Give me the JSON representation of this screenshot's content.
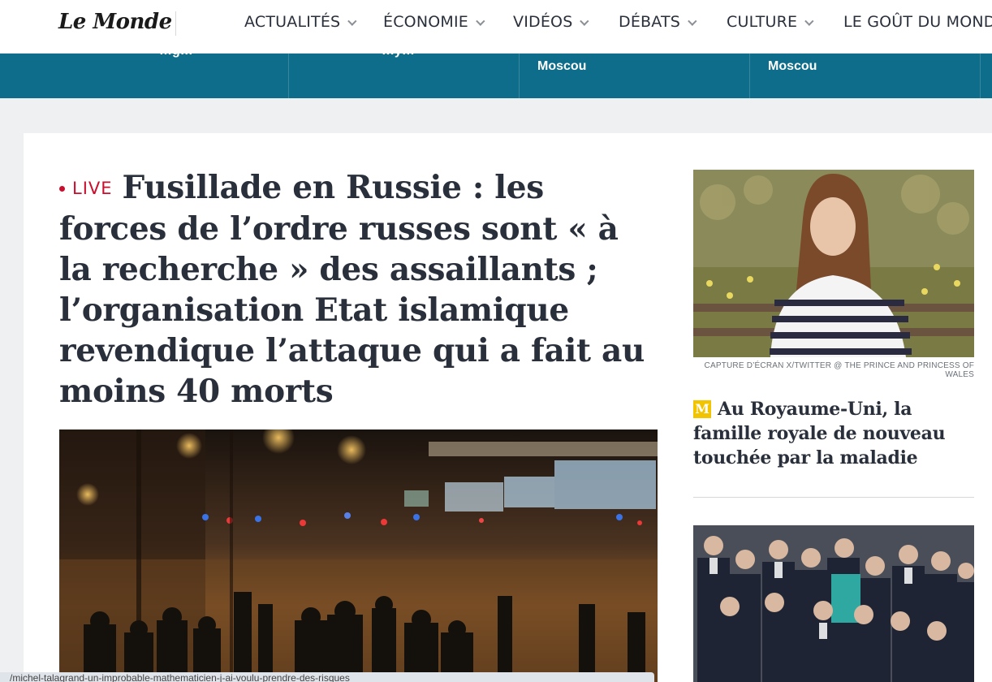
{
  "brand": {
    "logo": "Le Monde"
  },
  "nav": {
    "items": [
      {
        "label": "ACTUALITÉS",
        "has_dropdown": true
      },
      {
        "label": "ÉCONOMIE",
        "has_dropdown": true
      },
      {
        "label": "VIDÉOS",
        "has_dropdown": true
      },
      {
        "label": "DÉBATS",
        "has_dropdown": true
      },
      {
        "label": "CULTURE",
        "has_dropdown": true
      },
      {
        "label": "LE GOÛT DU MONDE",
        "has_dropdown": false
      }
    ]
  },
  "ticker": {
    "items": [
      {
        "text": "…g…"
      },
      {
        "text": "…y…"
      },
      {
        "text": "Moscou"
      },
      {
        "text": "Moscou"
      }
    ]
  },
  "main": {
    "live_label": "LIVE",
    "headline": "Fusillade en Russie : les forces de l’ordre russes sont « à la recherche » des assaillants ; l’organisation Etat islamique revendique l’attaque qui a fait au moins 40 morts"
  },
  "side": {
    "photo_caption": "CAPTURE D’ÉCRAN X/TWITTER @ THE PRINCE AND PRINCESS OF WALES",
    "badge": "M",
    "title": "Au Royaume-Uni, la famille royale de nouveau touchée par la maladie"
  },
  "status": {
    "url": "/michel-talagrand-un-improbable-mathematicien-j-ai-voulu-prendre-des-risques"
  },
  "colors": {
    "accent_teal": "#0d6d8a",
    "live_red": "#c8102e",
    "badge_yellow": "#f2c400"
  }
}
